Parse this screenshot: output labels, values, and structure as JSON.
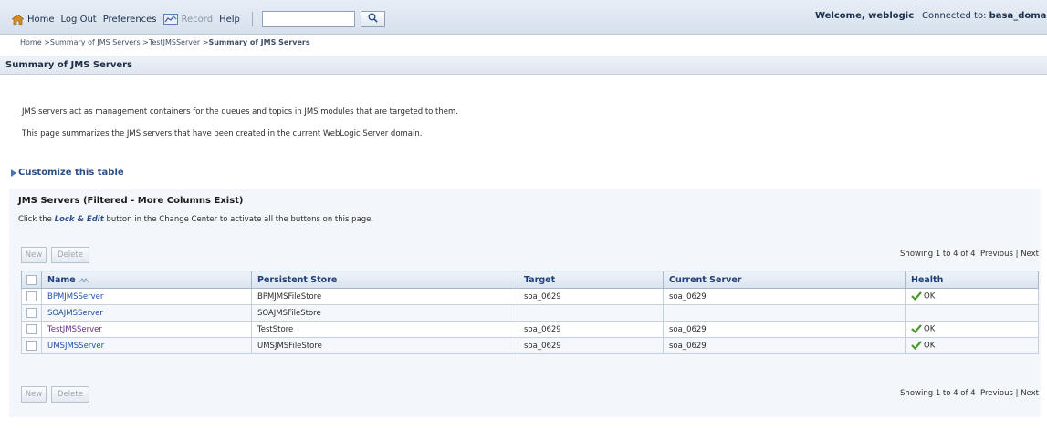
{
  "topbar": {
    "home": "Home",
    "logout": "Log Out",
    "preferences": "Preferences",
    "record": "Record",
    "help": "Help",
    "search_value": "",
    "welcome": "Welcome, weblogic",
    "connected_label": "Connected to:",
    "connected_domain": "basa_domai"
  },
  "breadcrumb": {
    "trail": "Home >Summary of JMS Servers >TestJMSServer >",
    "current": "Summary of JMS Servers"
  },
  "page": {
    "title": "Summary of JMS Servers",
    "desc1": "JMS servers act as management containers for the queues and topics in JMS modules that are targeted to them.",
    "desc2": "This page summarizes the JMS servers that have been created in the current WebLogic Server domain.",
    "customize": "Customize this table"
  },
  "panel": {
    "title": "JMS Servers (Filtered - More Columns Exist)",
    "note_prefix": "Click the ",
    "note_link": "Lock & Edit",
    "note_suffix": " button in the Change Center to activate all the buttons on this page."
  },
  "actions": {
    "new_label": "New",
    "delete_label": "Delete",
    "showing": "Showing 1 to 4 of 4",
    "previous": "Previous",
    "separator": "|",
    "next": "Next"
  },
  "table": {
    "columns": [
      "Name",
      "Persistent Store",
      "Target",
      "Current Server",
      "Health"
    ],
    "rows": [
      {
        "name": "BPMJMSServer",
        "store": "BPMJMSFileStore",
        "target": "soa_0629",
        "server": "soa_0629",
        "health": "OK"
      },
      {
        "name": "SOAJMSServer",
        "store": "SOAJMSFileStore",
        "target": "",
        "server": "",
        "health": ""
      },
      {
        "name": "TestJMSServer",
        "store": "TestStore",
        "target": "soa_0629",
        "server": "soa_0629",
        "health": "OK"
      },
      {
        "name": "UMSJMSServer",
        "store": "UMSJMSFileStore",
        "target": "soa_0629",
        "server": "soa_0629",
        "health": "OK"
      }
    ]
  },
  "colors": {
    "link": "#1f4fa3",
    "visited_link": "#6b2a8a",
    "ok_check": "#4a9a2a",
    "header_text": "#1f3f78"
  },
  "icons": {
    "home": "home-icon",
    "record": "record-icon",
    "search": "magnifier-icon",
    "sort": "sort-ascending-icon",
    "health_ok": "checkmark-icon",
    "expand": "triangle-right-icon"
  }
}
